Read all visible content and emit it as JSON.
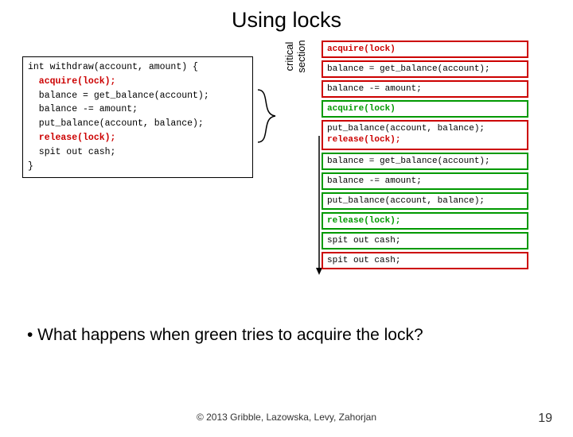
{
  "title": "Using locks",
  "code_box": {
    "lines": [
      "int withdraw(account, amount) {",
      "  acquire(lock);",
      "  balance = get_balance(account);",
      "  balance -= amount;",
      "  put_balance(account, balance);",
      "  release(lock);",
      "  spit out cash;",
      "}"
    ],
    "lock_line_indices": [
      1,
      5
    ]
  },
  "cs_label": "critical section",
  "timeline": [
    {
      "color": "red",
      "text": "acquire(lock)",
      "hl": "red"
    },
    {
      "color": "red",
      "text": "balance = get_balance(account);"
    },
    {
      "color": "red",
      "text": "balance -= amount;"
    },
    {
      "color": "green",
      "text": "acquire(lock)",
      "hl": "green"
    },
    {
      "color": "red",
      "text": "put_balance(account, balance);\nrelease(lock);",
      "twoline": true,
      "hl_lines": [
        null,
        "red"
      ]
    },
    {
      "color": "green",
      "text": "balance = get_balance(account);"
    },
    {
      "color": "green",
      "text": "balance -= amount;"
    },
    {
      "color": "green",
      "text": "put_balance(account, balance);"
    },
    {
      "color": "green",
      "text": "release(lock);",
      "hl": "green"
    },
    {
      "color": "green",
      "text": "spit out cash;"
    },
    {
      "color": "red",
      "text": "spit out cash;"
    }
  ],
  "bullet": "• What happens when green tries to acquire the lock?",
  "footer": "© 2013 Gribble, Lazowska, Levy, Zahorjan",
  "page_number": "19"
}
